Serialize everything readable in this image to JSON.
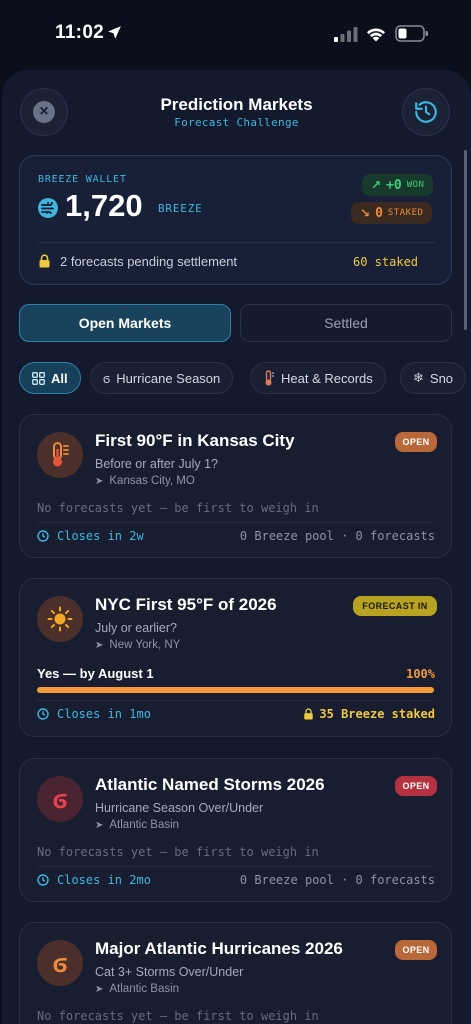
{
  "status_bar": {
    "time": "11:02"
  },
  "header": {
    "title": "Prediction Markets",
    "subtitle": "Forecast Challenge"
  },
  "wallet": {
    "label": "BREEZE WALLET",
    "amount": "1,720",
    "unit": "BREEZE",
    "won_value": "+0",
    "won_label": "WON",
    "staked_value": "0",
    "staked_label": "STAKED",
    "pending_text": "2 forecasts pending settlement",
    "pending_staked": "60 staked"
  },
  "tabs": [
    {
      "label": "Open Markets",
      "active": true
    },
    {
      "label": "Settled",
      "active": false
    }
  ],
  "filters": [
    {
      "label": "All",
      "icon": "grid-icon"
    },
    {
      "label": "Hurricane Season",
      "icon": "hurricane-icon"
    },
    {
      "label": "Heat & Records",
      "icon": "thermometer-icon"
    },
    {
      "label": "Sno",
      "icon": "snowflake-icon"
    }
  ],
  "markets": [
    {
      "title": "First 90°F in Kansas City",
      "subtitle": "Before or after July 1?",
      "location": "Kansas City, MO",
      "badge": "OPEN",
      "empty_text": "No forecasts yet — be first to weigh in",
      "closes": "Closes in 2w",
      "pool": "0 Breeze pool · 0 forecasts",
      "icon": "thermometer-icon"
    },
    {
      "title": "NYC First 95°F of 2026",
      "subtitle": "July or earlier?",
      "location": "New York, NY",
      "badge": "FORECAST IN",
      "choice": "Yes — by August 1",
      "choice_pct": "100%",
      "choice_fraction": 1.0,
      "closes": "Closes in 1mo",
      "staked": "35 Breeze staked",
      "icon": "sun-icon"
    },
    {
      "title": "Atlantic Named Storms 2026",
      "subtitle": "Hurricane Season Over/Under",
      "location": "Atlantic Basin",
      "badge": "OPEN",
      "empty_text": "No forecasts yet — be first to weigh in",
      "closes": "Closes in 2mo",
      "pool": "0 Breeze pool · 0 forecasts",
      "icon": "hurricane-icon"
    },
    {
      "title": "Major Atlantic Hurricanes 2026",
      "subtitle": "Cat 3+ Storms Over/Under",
      "location": "Atlantic Basin",
      "badge": "OPEN",
      "empty_text": "No forecasts yet — be first to weigh in",
      "icon": "hurricane-icon"
    }
  ],
  "colors": {
    "accent": "#3fb6e0",
    "badge_open_orange": "#b9683a",
    "badge_open_red": "#b5313f",
    "badge_forecast": "#b7a222",
    "progress": "#f59a3b",
    "staked_gold": "#f0c840"
  }
}
